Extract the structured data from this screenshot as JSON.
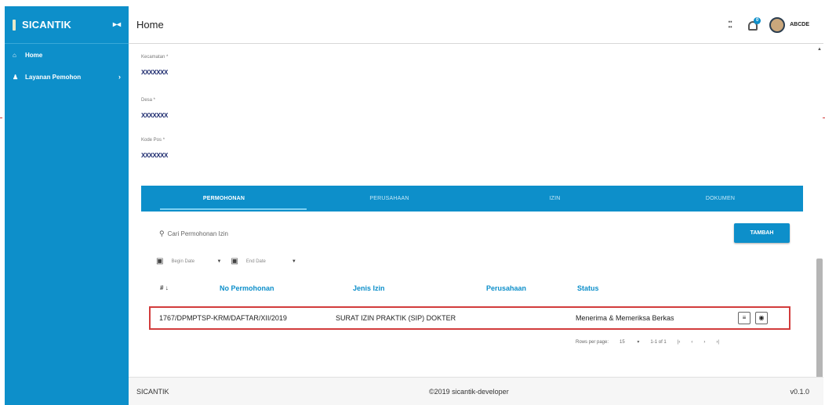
{
  "sidebar": {
    "brand": "SICANTIK",
    "collapse_icon": "double-chevron-right",
    "items": [
      {
        "label": "Home",
        "icon": "home-icon"
      },
      {
        "label": "Layanan Pemohon",
        "icon": "user-icon",
        "has_submenu": true
      }
    ]
  },
  "header": {
    "title": "Home",
    "notification_count": "0",
    "user_name": "ABCDE"
  },
  "fields": [
    {
      "label": "Kecamatan",
      "value": "XXXXXXX"
    },
    {
      "label": "Desa",
      "value": "XXXXXXX"
    },
    {
      "label": "Kode Pos",
      "value": "XXXXXXX"
    }
  ],
  "tabs": [
    "PERMOHONAN",
    "PERUSAHAAN",
    "IZIN",
    "DOKUMEN"
  ],
  "active_tab": "PERMOHONAN",
  "search": {
    "placeholder": "Cari Permohonan Izin"
  },
  "add_button": "TAMBAH",
  "date_filters": {
    "begin": "Begin Date",
    "end": "End Date"
  },
  "table": {
    "headers": [
      "No Permohonan",
      "Jenis Izin",
      "Perusahaan",
      "Status"
    ],
    "sort_label": "#",
    "rows": [
      {
        "no": "1767/DPMPTSP-KRM/DAFTAR/XII/2019",
        "jenis": "SURAT IZIN PRAKTIK (SIP) DOKTER",
        "perusahaan": "",
        "status": "Menerima & Memeriksa Berkas"
      }
    ]
  },
  "pagination": {
    "rows_label": "Rows per page:",
    "rows_value": "15",
    "range": "1-1 of 1"
  },
  "footer": {
    "brand": "SICANTIK",
    "copyright": "©2019 sicantik-developer",
    "version": "v0.1.0"
  },
  "colors": {
    "primary": "#0d8fca",
    "highlight_border": "#d23c3c"
  }
}
